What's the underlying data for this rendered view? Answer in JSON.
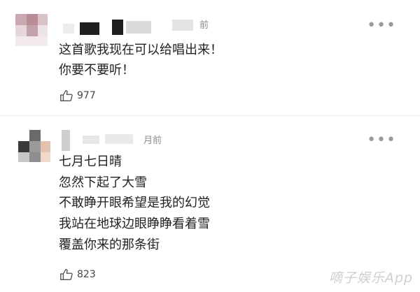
{
  "comments": [
    {
      "time": "前",
      "more": "•••",
      "lines": [
        "这首歌我现在可以给唱出来！",
        "你要不要听！"
      ],
      "likes": "977"
    },
    {
      "time": "月前",
      "more": "•••",
      "lines": [
        "七月七日晴",
        "忽然下起了大雪",
        "不敢睁开眼希望是我的幻觉",
        "我站在地球边眼睁睁看着雪",
        "覆盖你来的那条街"
      ],
      "likes": "823"
    }
  ],
  "watermark": "嘀子娱乐App",
  "icons": {
    "more": "more-dots-icon",
    "like": "thumbs-up-icon"
  },
  "colors": {
    "text": "#222222",
    "meta": "#8a8a8a",
    "divider": "#ebebeb"
  }
}
